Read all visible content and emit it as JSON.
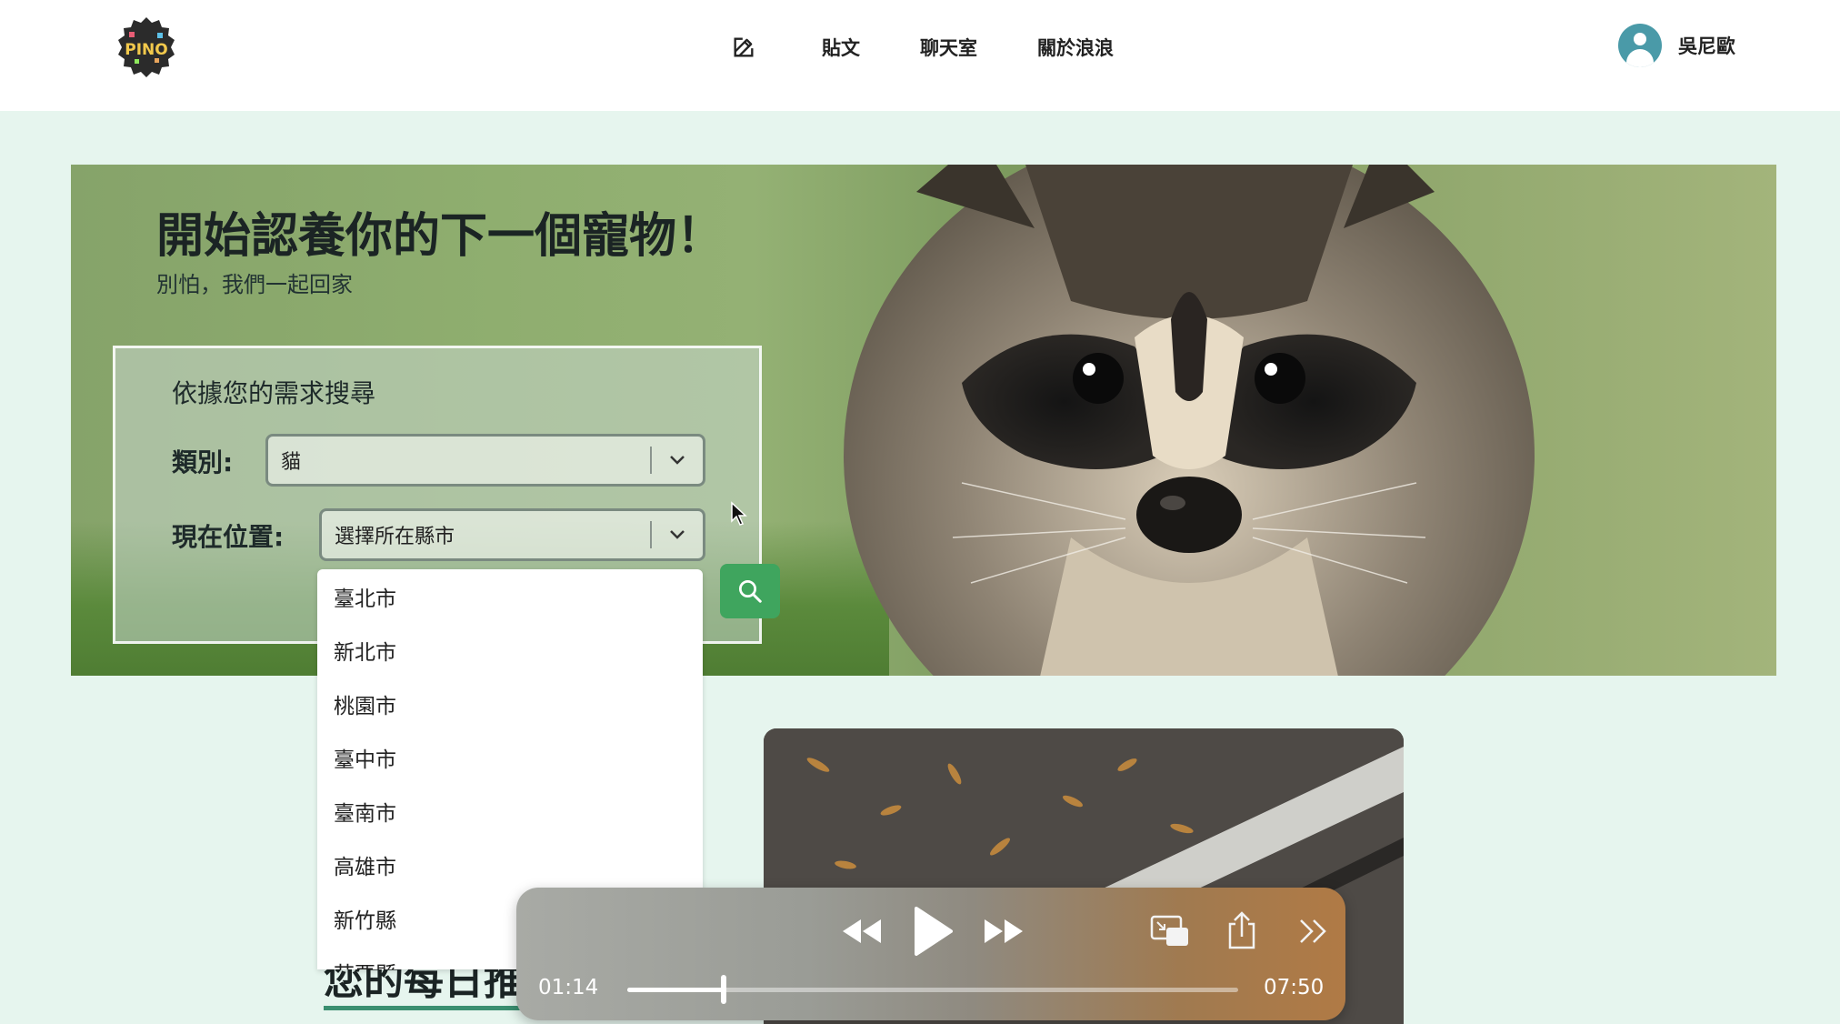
{
  "header": {
    "logo_text": "PINO",
    "nav": [
      {
        "label": "貼文"
      },
      {
        "label": "聊天室"
      },
      {
        "label": "關於浪浪"
      }
    ],
    "user_name": "吳尼歐"
  },
  "hero": {
    "title": "開始認養你的下一個寵物！",
    "subtitle": "別怕，我們一起回家",
    "search": {
      "title": "依據您的需求搜尋",
      "category_label": "類別:",
      "category_value": "貓",
      "location_label": "現在位置:",
      "location_placeholder": "選擇所在縣市"
    }
  },
  "dropdown": {
    "options": [
      "臺北市",
      "新北市",
      "桃園市",
      "臺中市",
      "臺南市",
      "高雄市",
      "新竹縣",
      "苗栗縣"
    ]
  },
  "daily": {
    "title": "您的每日推"
  },
  "player": {
    "current_time": "01:14",
    "total_time": "07:50",
    "progress": 0.158
  },
  "colors": {
    "page_bg": "#e6f5ee",
    "accent_green": "#3fa55e",
    "underline_green": "#3a8f70",
    "avatar": "#4a9aa8"
  }
}
